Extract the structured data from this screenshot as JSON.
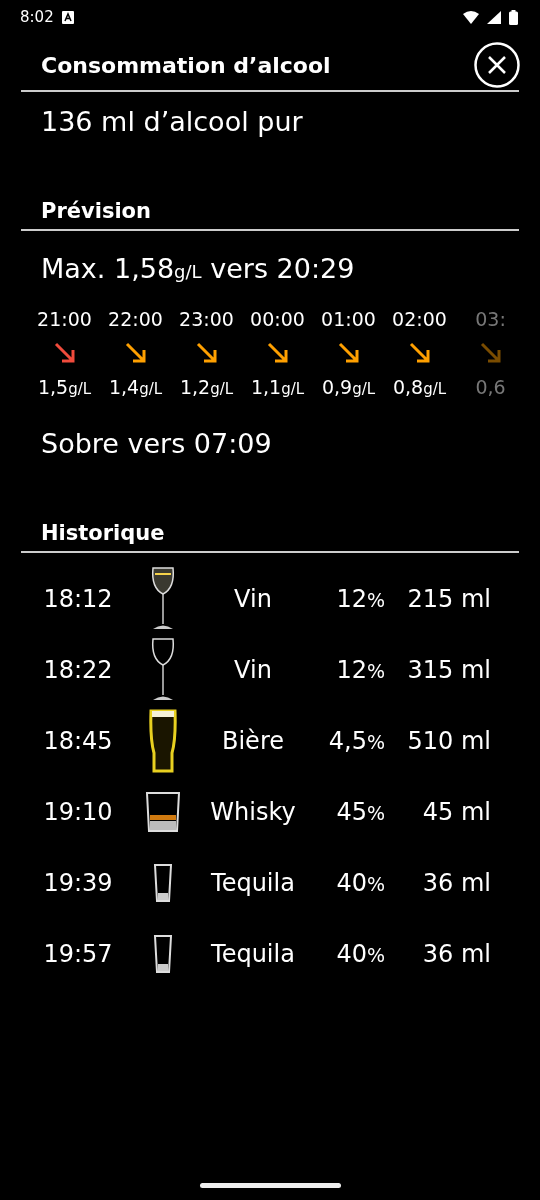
{
  "status_bar": {
    "time": "8:02"
  },
  "header": {
    "title": "Consommation d’alcool"
  },
  "total": "136 ml d’alcool pur",
  "forecast": {
    "title": "Prévision",
    "max_prefix": "Max. 1,58",
    "max_unit": "g/L",
    "max_suffix": " vers 20:29",
    "hours": [
      {
        "time": "21:00",
        "value": "1,5",
        "unit": "g/L",
        "color": "#f04b3c",
        "faded": false
      },
      {
        "time": "22:00",
        "value": "1,4",
        "unit": "g/L",
        "color": "#ffa000",
        "faded": false
      },
      {
        "time": "23:00",
        "value": "1,2",
        "unit": "g/L",
        "color": "#ffa000",
        "faded": false
      },
      {
        "time": "00:00",
        "value": "1,1",
        "unit": "g/L",
        "color": "#ffa000",
        "faded": false
      },
      {
        "time": "01:00",
        "value": "0,9",
        "unit": "g/L",
        "color": "#ffa000",
        "faded": false
      },
      {
        "time": "02:00",
        "value": "0,8",
        "unit": "g/L",
        "color": "#ffa000",
        "faded": false
      },
      {
        "time": "03:",
        "value": "0,6",
        "color": "#7a4c00",
        "faded": true
      }
    ],
    "sober": "Sobre vers 07:09"
  },
  "history": {
    "title": "Historique",
    "rows": [
      {
        "time": "18:12",
        "kind": "white-wine",
        "name": "Vin",
        "abv": "12",
        "abv_unit": "%",
        "volume": "215 ml"
      },
      {
        "time": "18:22",
        "kind": "red-wine",
        "name": "Vin",
        "abv": "12",
        "abv_unit": "%",
        "volume": "315 ml"
      },
      {
        "time": "18:45",
        "kind": "beer",
        "name": "Bière",
        "abv": "4,5",
        "abv_unit": "%",
        "volume": "510 ml"
      },
      {
        "time": "19:10",
        "kind": "whisky",
        "name": "Whisky",
        "abv": "45",
        "abv_unit": "%",
        "volume": "45 ml"
      },
      {
        "time": "19:39",
        "kind": "shot",
        "name": "Tequila",
        "abv": "40",
        "abv_unit": "%",
        "volume": "36 ml"
      },
      {
        "time": "19:57",
        "kind": "shot",
        "name": "Tequila",
        "abv": "40",
        "abv_unit": "%",
        "volume": "36 ml"
      }
    ]
  }
}
